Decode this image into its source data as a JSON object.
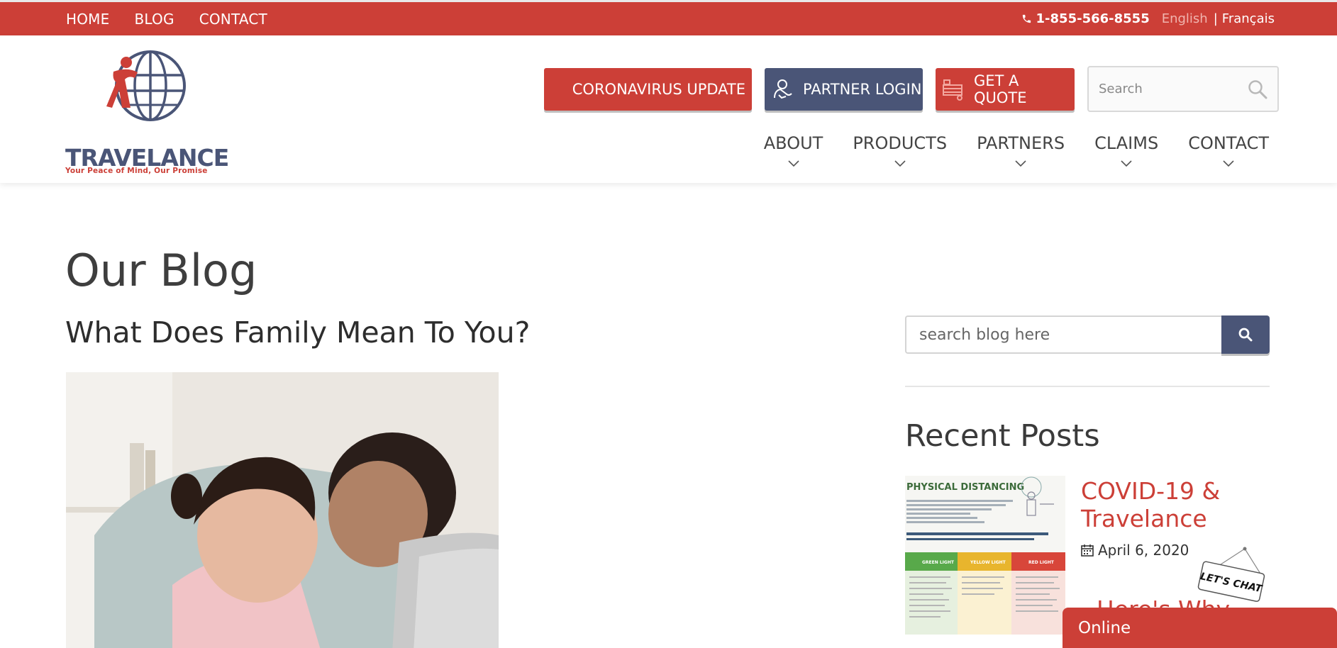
{
  "topbar": {
    "nav": [
      "HOME",
      "BLOG",
      "CONTACT"
    ],
    "phone": "1-855-566-8555",
    "lang_active": "English",
    "lang_separator": "|",
    "lang_other": "Français"
  },
  "header": {
    "logo_word": "TRAVELANCE",
    "logo_tagline": "Your Peace of Mind, Our Promise",
    "buttons": {
      "covid": "CORONAVIRUS UPDATE",
      "partner": "PARTNER LOGIN",
      "quote": "GET A QUOTE"
    },
    "search_placeholder": "Search",
    "nav": [
      "ABOUT",
      "PRODUCTS",
      "PARTNERS",
      "CLAIMS",
      "CONTACT"
    ]
  },
  "main": {
    "page_title": "Our Blog",
    "post_title": "What Does Family Mean To You?"
  },
  "sidebar": {
    "search_placeholder": "search blog here",
    "recent_title": "Recent Posts",
    "recent_posts": [
      {
        "title": "COVID-19 & Travelance",
        "date": "April 6, 2020",
        "thumb_heading": "PHYSICAL DISTANCING",
        "thumb_columns": [
          "GREEN LIGHT",
          "YELLOW LIGHT",
          "RED LIGHT"
        ]
      },
      {
        "title": "Here's Why"
      }
    ]
  },
  "chat": {
    "sign_text": "LET'S CHAT",
    "status": "Online"
  },
  "colors": {
    "brand_red": "#cc3f37",
    "brand_navy": "#4a5577"
  }
}
